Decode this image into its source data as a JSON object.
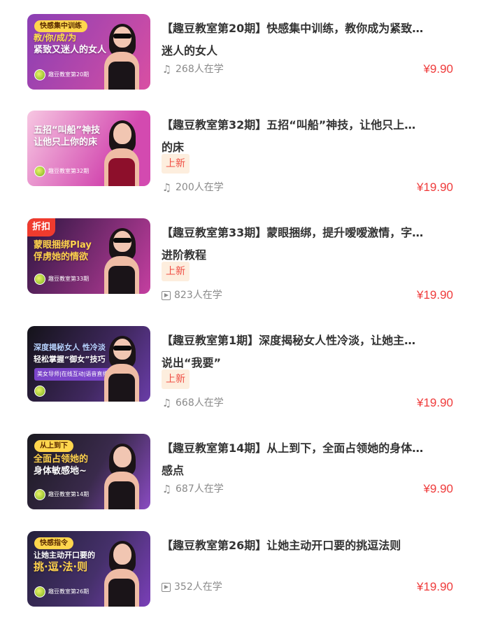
{
  "courses": [
    {
      "title_line1": "【趣豆教室第20期】快感集中训练，教你成为紧致…",
      "title_line2": "迷人的女人",
      "is_new": false,
      "new_label": "",
      "discount_label": "",
      "media_icon": "music-note-icon",
      "learners": "268人在学",
      "price": "¥9.90",
      "thumb": {
        "pill": "快感集中训练",
        "headline": "教/你/成/为",
        "headline2": "紧致又迷人的女人",
        "brand": "趣豆教室第20期",
        "bg": [
          "#8a3fb4",
          "#d94fa3"
        ]
      }
    },
    {
      "title_line1": "【趣豆教室第32期】五招“叫船”神技，让他只上…",
      "title_line2": "的床",
      "is_new": true,
      "new_label": "上新",
      "discount_label": "",
      "media_icon": "music-note-icon",
      "learners": "200人在学",
      "price": "¥19.90",
      "thumb": {
        "pill": "",
        "headline": "五招“叫船”神技",
        "headline2": "让他只上你的床",
        "brand": "趣豆教室第32期",
        "bg": [
          "#f0b9d9",
          "#d34ab0"
        ]
      }
    },
    {
      "title_line1": "【趣豆教室第33期】蒙眼捆绑，提升嗳嗳激情，字…",
      "title_line2": "进阶教程",
      "is_new": true,
      "new_label": "上新",
      "discount_label": "折扣",
      "media_icon": "video-play-icon",
      "learners": "823人在学",
      "price": "¥19.90",
      "thumb": {
        "pill": "",
        "headline": "蒙眼捆绑Play",
        "headline2": "俘虏她的情欲",
        "brand": "趣豆教室第33期",
        "bg": [
          "#3a1850",
          "#c43fa0"
        ]
      }
    },
    {
      "title_line1": "【趣豆教室第1期】深度揭秘女人性冷淡，让她主…",
      "title_line2": "说出“我要”",
      "is_new": true,
      "new_label": "上新",
      "discount_label": "",
      "media_icon": "music-note-icon",
      "learners": "668人在学",
      "price": "¥19.90",
      "thumb": {
        "pill": "",
        "headline": "深度揭秘女人 性冷淡",
        "headline2": "轻松掌握“御女”技巧",
        "brand": "美女导师|在线互动|语音直播",
        "bg": [
          "#1c1b2a",
          "#6a3da8"
        ]
      }
    },
    {
      "title_line1": "【趣豆教室第14期】从上到下，全面占领她的身体…",
      "title_line2": "感点",
      "is_new": false,
      "new_label": "",
      "discount_label": "",
      "media_icon": "music-note-icon",
      "learners": "687人在学",
      "price": "¥9.90",
      "thumb": {
        "pill": "从上到下",
        "headline": "全面占领她的",
        "headline2": "身体敏感地~",
        "brand": "趣豆教室第14期",
        "bg": [
          "#23202a",
          "#8a4bc2"
        ]
      }
    },
    {
      "title_line1": "【趣豆教室第26期】让她主动开口要的挑逗法则",
      "title_line2": "",
      "is_new": false,
      "new_label": "",
      "discount_label": "",
      "media_icon": "video-play-icon",
      "learners": "352人在学",
      "price": "¥19.90",
      "thumb": {
        "pill": "快感指令",
        "headline": "让她主动开口要的",
        "headline2": "挑·逗·法·则",
        "brand": "趣豆教室第26期",
        "bg": [
          "#2a2340",
          "#7a3fb8"
        ]
      }
    }
  ]
}
